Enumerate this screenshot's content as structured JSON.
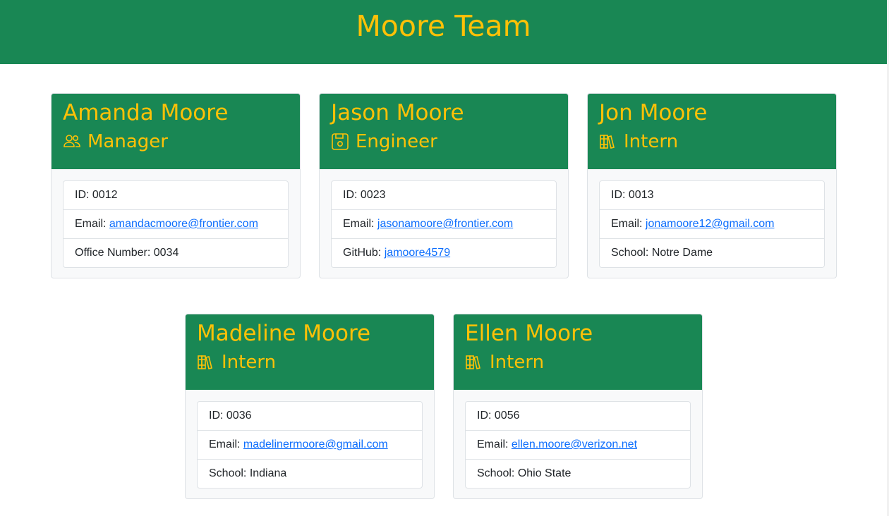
{
  "page": {
    "title": "Moore Team"
  },
  "colors": {
    "header_bg": "#198754",
    "accent_text": "#ffc107",
    "link": "#0d6efd"
  },
  "employees": [
    {
      "name": "Amanda Moore",
      "role": "Manager",
      "role_icon": "people-icon",
      "id_label": "ID: ",
      "id": "0012",
      "email_label": "Email: ",
      "email": "amandacmoore@frontier.com",
      "extra_label": "Office Number: ",
      "extra": "0034"
    },
    {
      "name": "Jason Moore",
      "role": "Engineer",
      "role_icon": "floppy-disk-icon",
      "id_label": "ID: ",
      "id": "0023",
      "email_label": "Email: ",
      "email": "jasonamoore@frontier.com",
      "extra_label": "GitHub: ",
      "extra": "jamoore4579"
    },
    {
      "name": "Jon Moore",
      "role": "Intern",
      "role_icon": "books-icon",
      "id_label": "ID: ",
      "id": "0013",
      "email_label": "Email: ",
      "email": "jonamoore12@gmail.com",
      "extra_label": "School: ",
      "extra": "Notre Dame"
    },
    {
      "name": "Madeline Moore",
      "role": "Intern",
      "role_icon": "books-icon",
      "id_label": "ID: ",
      "id": "0036",
      "email_label": "Email: ",
      "email": "madelinermoore@gmail.com",
      "extra_label": "School: ",
      "extra": "Indiana"
    },
    {
      "name": "Ellen Moore",
      "role": "Intern",
      "role_icon": "books-icon",
      "id_label": "ID: ",
      "id": "0056",
      "email_label": "Email: ",
      "email": "ellen.moore@verizon.net",
      "extra_label": "School: ",
      "extra": "Ohio State"
    }
  ]
}
